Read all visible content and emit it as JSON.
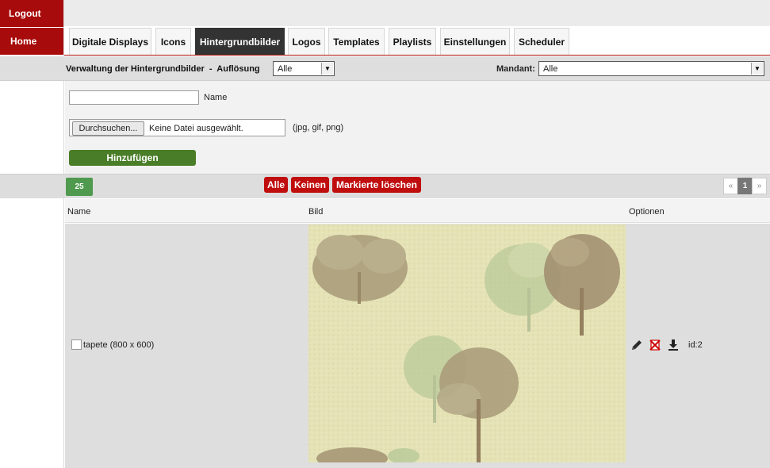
{
  "sidebar": {
    "logout": "Logout",
    "home": "Home"
  },
  "tabs": [
    {
      "label": "Digitale Displays",
      "active": false
    },
    {
      "label": "Icons",
      "active": false
    },
    {
      "label": "Hintergrundbilder",
      "active": true
    },
    {
      "label": "Logos",
      "active": false
    },
    {
      "label": "Templates",
      "active": false
    },
    {
      "label": "Playlists",
      "active": false
    },
    {
      "label": "Einstellungen",
      "active": false
    },
    {
      "label": "Scheduler",
      "active": false
    }
  ],
  "filter": {
    "title": "Verwaltung der Hintergrundbilder  -  Auflösung",
    "resolution_value": "Alle",
    "mandant_label": "Mandant:",
    "mandant_value": "Alle"
  },
  "form": {
    "name_value": "",
    "name_label": "Name",
    "browse_label": "Durchsuchen...",
    "file_status": "Keine Datei ausgewählt.",
    "file_hint": "(jpg, gif, png)",
    "add_label": "Hinzufügen"
  },
  "actions": {
    "per_page": "25",
    "all_label": "Alle",
    "none_label": "Keinen",
    "delete_marked_label": "Markierte löschen"
  },
  "pagination": {
    "prev": "«",
    "current": "1",
    "next": "»"
  },
  "table": {
    "columns": {
      "name": "Name",
      "image": "Bild",
      "options": "Optionen"
    },
    "rows": [
      {
        "name": "tapete (800 x 600)",
        "id": "id:2",
        "checked": false
      }
    ]
  },
  "icons": {
    "edit": "pencil-icon",
    "delete": "delete-cross-icon",
    "download": "download-icon"
  },
  "colors": {
    "brand_red": "#a80b0b",
    "active_tab": "#333333",
    "add_green": "#4a7d27",
    "action_red": "#c00d0d",
    "per_page_green": "#4f9a4f"
  }
}
